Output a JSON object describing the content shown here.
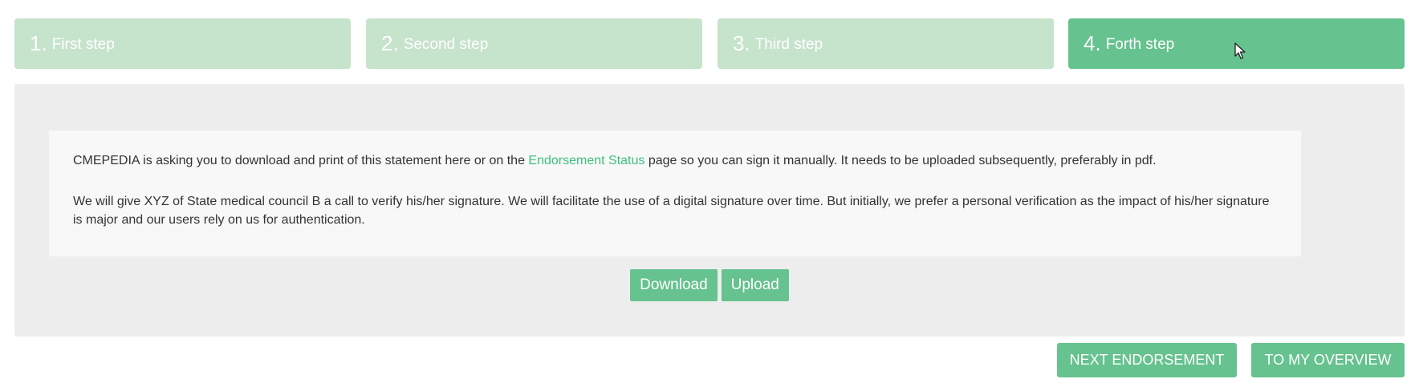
{
  "steps": [
    {
      "num": "1.",
      "label": "First step",
      "active": false
    },
    {
      "num": "2.",
      "label": "Second step",
      "active": false
    },
    {
      "num": "3.",
      "label": "Third step",
      "active": false
    },
    {
      "num": "4.",
      "label": "Forth step",
      "active": true
    }
  ],
  "statement": {
    "p1_before": "CMEPEDIA is asking you to download and print of this statement here or on the ",
    "p1_link": "Endorsement Status",
    "p1_after": " page so you can sign it manually. It needs to be uploaded subsequently, preferably in pdf.",
    "p2": "We will give XYZ of State medical council B a call to verify his/her signature. We will facilitate the use of a digital signature over time. But initially, we prefer a personal verification as the impact of his/her signature is major and our users rely on us for authentication."
  },
  "actions": {
    "download": "Download",
    "upload": "Upload"
  },
  "footer": {
    "next_endorsement": "NEXT ENDORSEMENT",
    "to_my_overview": "TO MY OVERVIEW"
  },
  "colors": {
    "step_inactive": "#c6e3cc",
    "step_active": "#66c28e",
    "button": "#66c28e",
    "link": "#3fbf7f",
    "panel": "#ededed"
  },
  "icons": {
    "cursor": "mouse-pointer-icon"
  }
}
